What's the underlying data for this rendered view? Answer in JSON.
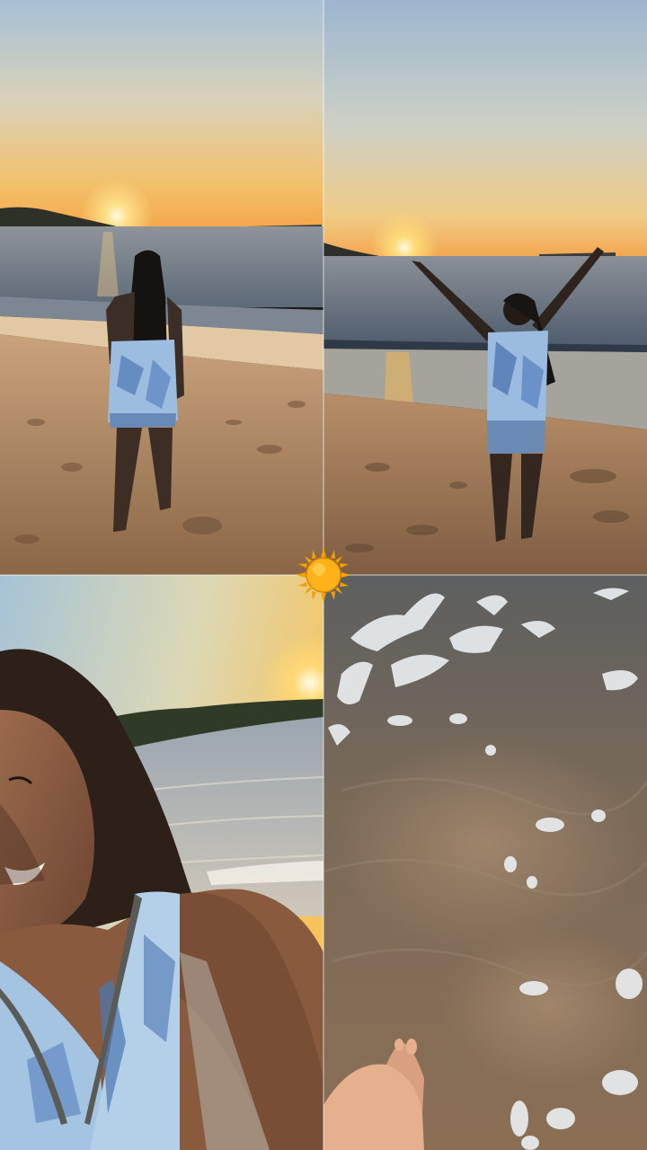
{
  "collage": {
    "layout": "2x2 grid",
    "tiles": [
      {
        "scene": "beach-sunset-back-view"
      },
      {
        "scene": "beach-sunset-arms-raised"
      },
      {
        "scene": "selfie-at-sunset-beach"
      },
      {
        "scene": "sea-foam-over-sand"
      }
    ]
  },
  "sticker": {
    "icon": "sun-emoji-icon",
    "color": "#f6a400"
  },
  "palette": {
    "sky_top": "#a9c3d6",
    "sky_glow": "#f5c46a",
    "sea": "#6e7a86",
    "sand": "#b58a63",
    "top_tie_dye": "#8fb6de"
  }
}
